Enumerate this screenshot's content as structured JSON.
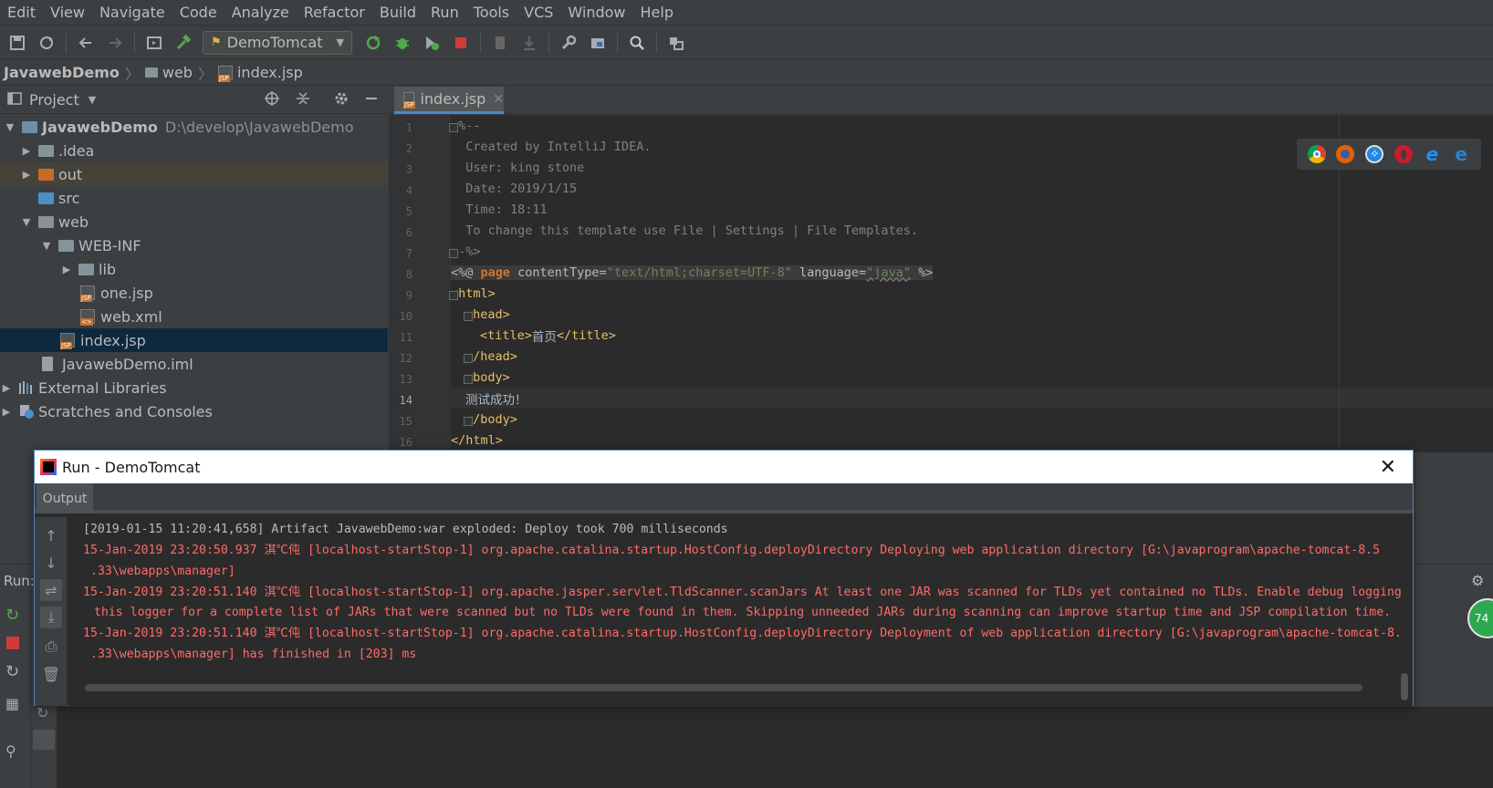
{
  "menu": [
    "Edit",
    "View",
    "Navigate",
    "Code",
    "Analyze",
    "Refactor",
    "Build",
    "Run",
    "Tools",
    "VCS",
    "Window",
    "Help"
  ],
  "toolbar": {
    "run_config": "DemoTomcat",
    "icons": [
      "save-icon",
      "sync-icon",
      "back-icon",
      "forward-icon",
      "frame-icon",
      "build-hammer-icon",
      "rerun-icon",
      "debug-icon",
      "coverage-icon",
      "stop-icon",
      "bookmark-icon",
      "download-icon",
      "settings-wrench-icon",
      "project-structure-icon",
      "search-icon",
      "database-icon"
    ]
  },
  "breadcrumb": [
    "JavawebDemo",
    "web",
    "index.jsp"
  ],
  "project": {
    "title": "Project",
    "tree": [
      {
        "label": "JavawebDemo",
        "path": "D:\\develop\\JavawebDemo"
      },
      {
        "label": ".idea"
      },
      {
        "label": "out"
      },
      {
        "label": "src"
      },
      {
        "label": "web"
      },
      {
        "label": "WEB-INF"
      },
      {
        "label": "lib"
      },
      {
        "label": "one.jsp"
      },
      {
        "label": "web.xml"
      },
      {
        "label": "index.jsp"
      },
      {
        "label": "JavawebDemo.iml"
      },
      {
        "label": "External Libraries"
      },
      {
        "label": "Scratches and Consoles"
      }
    ]
  },
  "editor": {
    "tab": "index.jsp",
    "line_numbers": [
      "1",
      "2",
      "3",
      "4",
      "5",
      "6",
      "7",
      "8",
      "9",
      "10",
      "11",
      "12",
      "13",
      "14",
      "15",
      "16"
    ],
    "lines": {
      "l1": "<%--",
      "l2": "  Created by IntelliJ IDEA.",
      "l3": "  User: king stone",
      "l4": "  Date: 2019/1/15",
      "l5": "  Time: 18:11",
      "l6": "  To change this template use File | Settings | File Templates.",
      "l7": "--%>",
      "l8_open": "<%@ ",
      "l8_kw": "page",
      "l8_attr1": " contentType=",
      "l8_val1": "\"text/html;charset=UTF-8\"",
      "l8_attr2": " language=",
      "l8_val2": "\"java\"",
      "l8_close": " %>",
      "l9": "<html>",
      "l10": "<head>",
      "l11_open": "<title>",
      "l11_text": "首页",
      "l11_close": "</title>",
      "l12": "</head>",
      "l13": "<body>",
      "l14": "测试成功！",
      "l15": "</body>",
      "l16": "</html>"
    }
  },
  "bottom": {
    "run_label": "Run:",
    "memory": "74"
  },
  "dialog": {
    "title": "Run - DemoTomcat",
    "tab": "Output",
    "console": [
      "[2019-01-15 11:20:41,658] Artifact JavawebDemo:war exploded: Deploy took 700 milliseconds",
      "15-Jan-2019 23:20:50.937 淇℃伅 [localhost-startStop-1] org.apache.catalina.startup.HostConfig.deployDirectory Deploying web application directory [G:\\javaprogram\\apache-tomcat-8.5",
      ".33\\webapps\\manager]",
      "15-Jan-2019 23:20:51.140 淇℃伅 [localhost-startStop-1] org.apache.jasper.servlet.TldScanner.scanJars At least one JAR was scanned for TLDs yet contained no TLDs. Enable debug logging",
      " this logger for a complete list of JARs that were scanned but no TLDs were found in them. Skipping unneeded JARs during scanning can improve startup time and JSP compilation time.",
      "15-Jan-2019 23:20:51.140 淇℃伅 [localhost-startStop-1] org.apache.catalina.startup.HostConfig.deployDirectory Deployment of web application directory [G:\\javaprogram\\apache-tomcat-8.",
      ".33\\webapps\\manager] has finished in [203] ms"
    ]
  },
  "colors": {
    "background": "#3c3f41",
    "editor_bg": "#2b2b2b",
    "selection": "#0d293e",
    "error_text": "#ff6b68",
    "tag": "#e8bf6a",
    "keyword": "#cc7832",
    "string": "#6a8759",
    "accent": "#4a88c7"
  }
}
